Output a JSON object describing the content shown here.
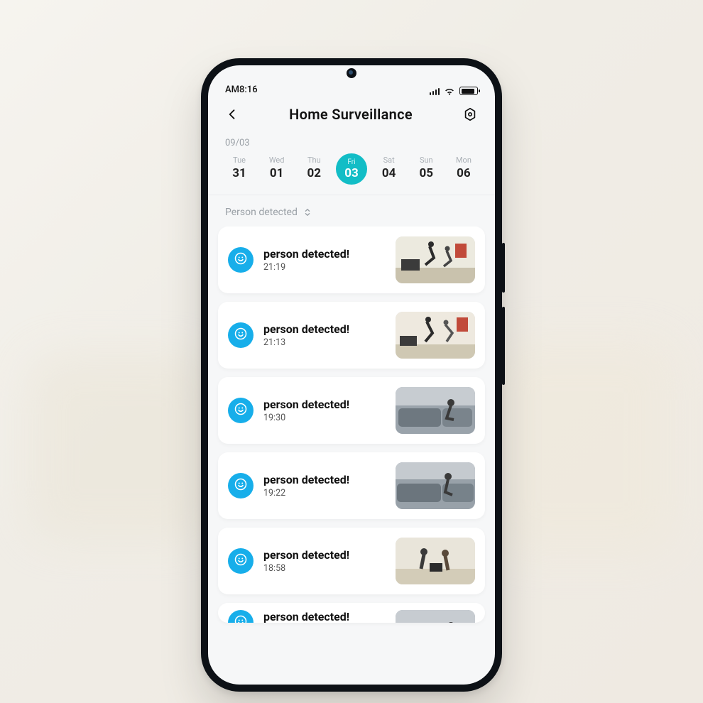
{
  "status": {
    "time": "AM8:16"
  },
  "header": {
    "title": "Home  Surveillance"
  },
  "date": {
    "label": "09/03"
  },
  "days": [
    {
      "dow": "Tue",
      "dom": "31",
      "selected": false
    },
    {
      "dow": "Wed",
      "dom": "01",
      "selected": false
    },
    {
      "dow": "Thu",
      "dom": "02",
      "selected": false
    },
    {
      "dow": "Fri",
      "dom": "03",
      "selected": true
    },
    {
      "dow": "Sat",
      "dom": "04",
      "selected": false
    },
    {
      "dow": "Sun",
      "dom": "05",
      "selected": false
    },
    {
      "dow": "Mon",
      "dom": "06",
      "selected": false
    }
  ],
  "filter": {
    "label": "Person detected"
  },
  "events": [
    {
      "title": "person detected!",
      "time": "21:19",
      "thumb": "room-play-1"
    },
    {
      "title": "person detected!",
      "time": "21:13",
      "thumb": "room-play-2"
    },
    {
      "title": "person detected!",
      "time": "19:30",
      "thumb": "room-couch-1"
    },
    {
      "title": "person detected!",
      "time": "19:22",
      "thumb": "room-couch-2"
    },
    {
      "title": "person detected!",
      "time": "18:58",
      "thumb": "room-couple"
    }
  ],
  "peek": {
    "title": "person detected!"
  },
  "colors": {
    "accent": "#12bdc6",
    "badge": "#17aeea"
  }
}
